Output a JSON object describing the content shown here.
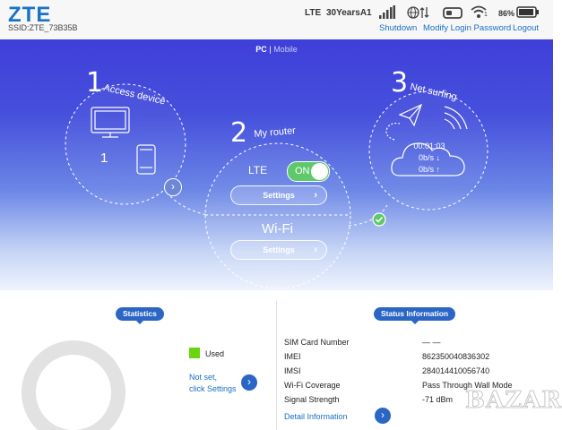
{
  "header": {
    "logo": "ZTE",
    "ssid": "SSID:ZTE_73B35B",
    "network_type": "LTE",
    "operator": "30YearsA1",
    "battery": "86%",
    "wifi_clients": "1",
    "links": {
      "shutdown": "Shutdown",
      "modify_password": "Modify Login Password",
      "logout": "Logout"
    }
  },
  "view_switch": {
    "pc": "PC",
    "separator": "|",
    "mobile": "Mobile"
  },
  "steps": {
    "access": {
      "number": "1",
      "label": "Access device",
      "count": "1"
    },
    "router": {
      "number": "2",
      "label": "My router",
      "lte_label": "LTE",
      "lte_state": "ON",
      "settings_label": "Settings",
      "wifi_label": "Wi-Fi",
      "wifi_settings_label": "Settings"
    },
    "surfing": {
      "number": "3",
      "label": "Net surfing",
      "time": "00:01:03",
      "download": "0b/s ↓",
      "upload": "0b/s ↑"
    }
  },
  "statistics": {
    "tag": "Statistics",
    "legend_used": "Used",
    "not_set_line1": "Not set,",
    "not_set_line2": "click Settings"
  },
  "status": {
    "tag": "Status Information",
    "rows": [
      {
        "label": "SIM Card Number",
        "value": "— —"
      },
      {
        "label": "IMEI",
        "value": "862350040836302"
      },
      {
        "label": "IMSI",
        "value": "284014410056740"
      },
      {
        "label": "Wi-Fi Coverage",
        "value": "Pass Through Wall Mode"
      },
      {
        "label": "Signal Strength",
        "value": "-71 dBm"
      }
    ],
    "detail_link": "Detail Information"
  },
  "watermark": "BAZAR",
  "colors": {
    "accent": "#2b66c5",
    "toggle_on": "#5ec86a",
    "used": "#6ad40e"
  }
}
